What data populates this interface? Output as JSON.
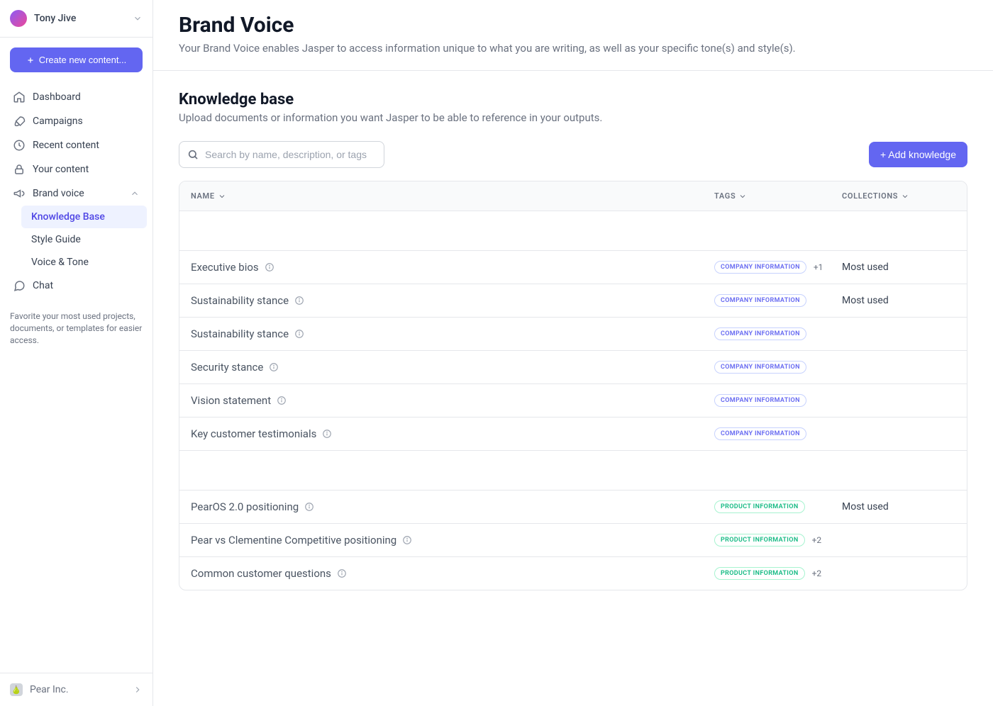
{
  "user": {
    "name": "Tony Jive"
  },
  "create_button": "Create new content...",
  "nav": {
    "dashboard": "Dashboard",
    "campaigns": "Campaigns",
    "recent": "Recent content",
    "your_content": "Your content",
    "brand_voice": "Brand voice",
    "chat": "Chat",
    "sub": {
      "knowledge_base": "Knowledge Base",
      "style_guide": "Style Guide",
      "voice_tone": "Voice & Tone"
    }
  },
  "favorite_note": "Favorite your most used projects, documents, or templates for easier access.",
  "org": {
    "name": "Pear Inc."
  },
  "page": {
    "title": "Brand Voice",
    "subtitle": "Your Brand Voice enables Jasper to access information unique to what you are writing, as well as your specific tone(s) and style(s)."
  },
  "knowledge": {
    "title": "Knowledge base",
    "desc": "Upload documents or information you want Jasper to be able to reference in your outputs.",
    "search_placeholder": "Search by name, description, or tags",
    "add_button": "+ Add knowledge",
    "columns": {
      "name": "NAME",
      "tags": "TAGS",
      "collections": "COLLECTIONS"
    },
    "tags": {
      "company": "COMPANY INFORMATION",
      "product": "PRODUCT INFORMATION"
    },
    "rows": [
      {
        "name": "Executive bios",
        "tag": "company",
        "extra": "+1",
        "collection": "Most used"
      },
      {
        "name": "Sustainability stance",
        "tag": "company",
        "extra": "",
        "collection": "Most used"
      },
      {
        "name": "Sustainability stance",
        "tag": "company",
        "extra": "",
        "collection": ""
      },
      {
        "name": "Security stance",
        "tag": "company",
        "extra": "",
        "collection": ""
      },
      {
        "name": "Vision statement",
        "tag": "company",
        "extra": "",
        "collection": ""
      },
      {
        "name": "Key customer testimonials",
        "tag": "company",
        "extra": "",
        "collection": ""
      }
    ],
    "rows2": [
      {
        "name": "PearOS 2.0 positioning",
        "tag": "product",
        "extra": "",
        "collection": "Most used"
      },
      {
        "name": "Pear vs Clementine Competitive positioning",
        "tag": "product",
        "extra": "+2",
        "collection": ""
      },
      {
        "name": "Common customer questions",
        "tag": "product",
        "extra": "+2",
        "collection": ""
      }
    ]
  }
}
